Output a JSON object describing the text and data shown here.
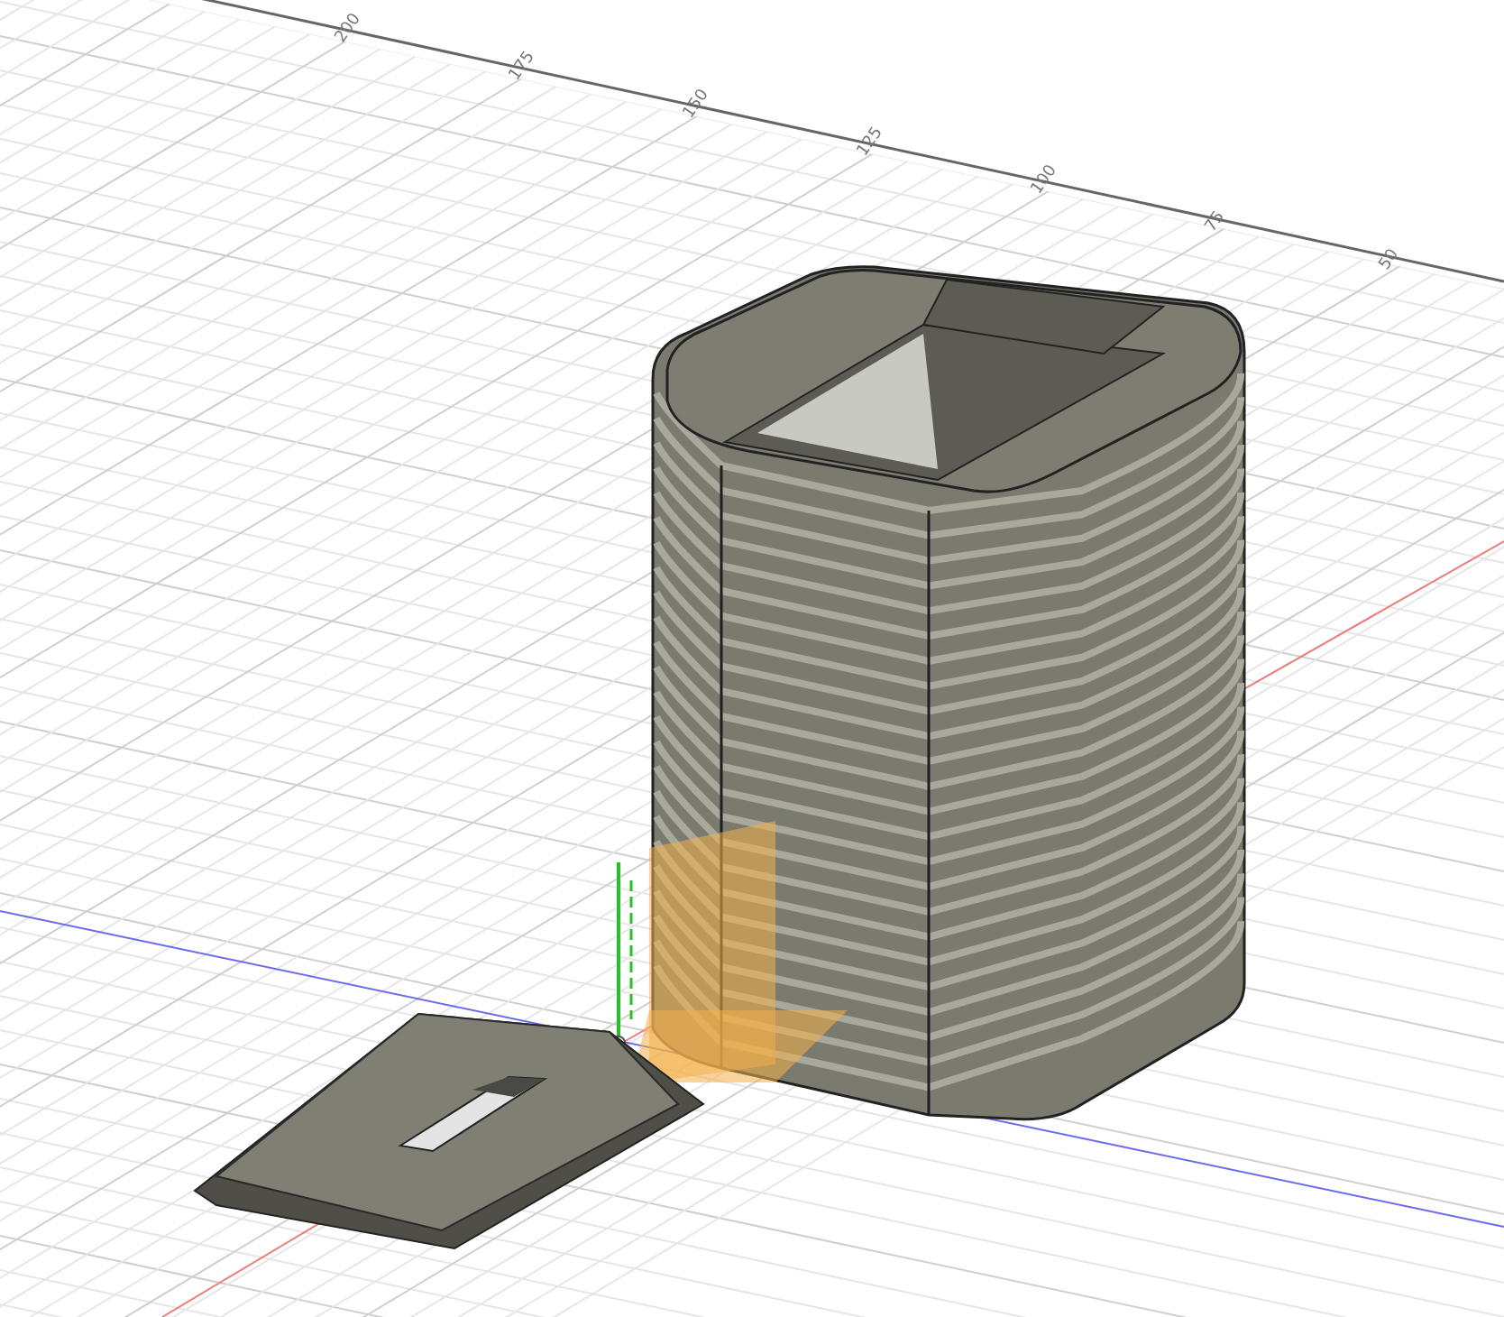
{
  "viewport": {
    "ruler_labels": [
      "200",
      "175",
      "150",
      "125",
      "100",
      "75",
      "50"
    ]
  }
}
